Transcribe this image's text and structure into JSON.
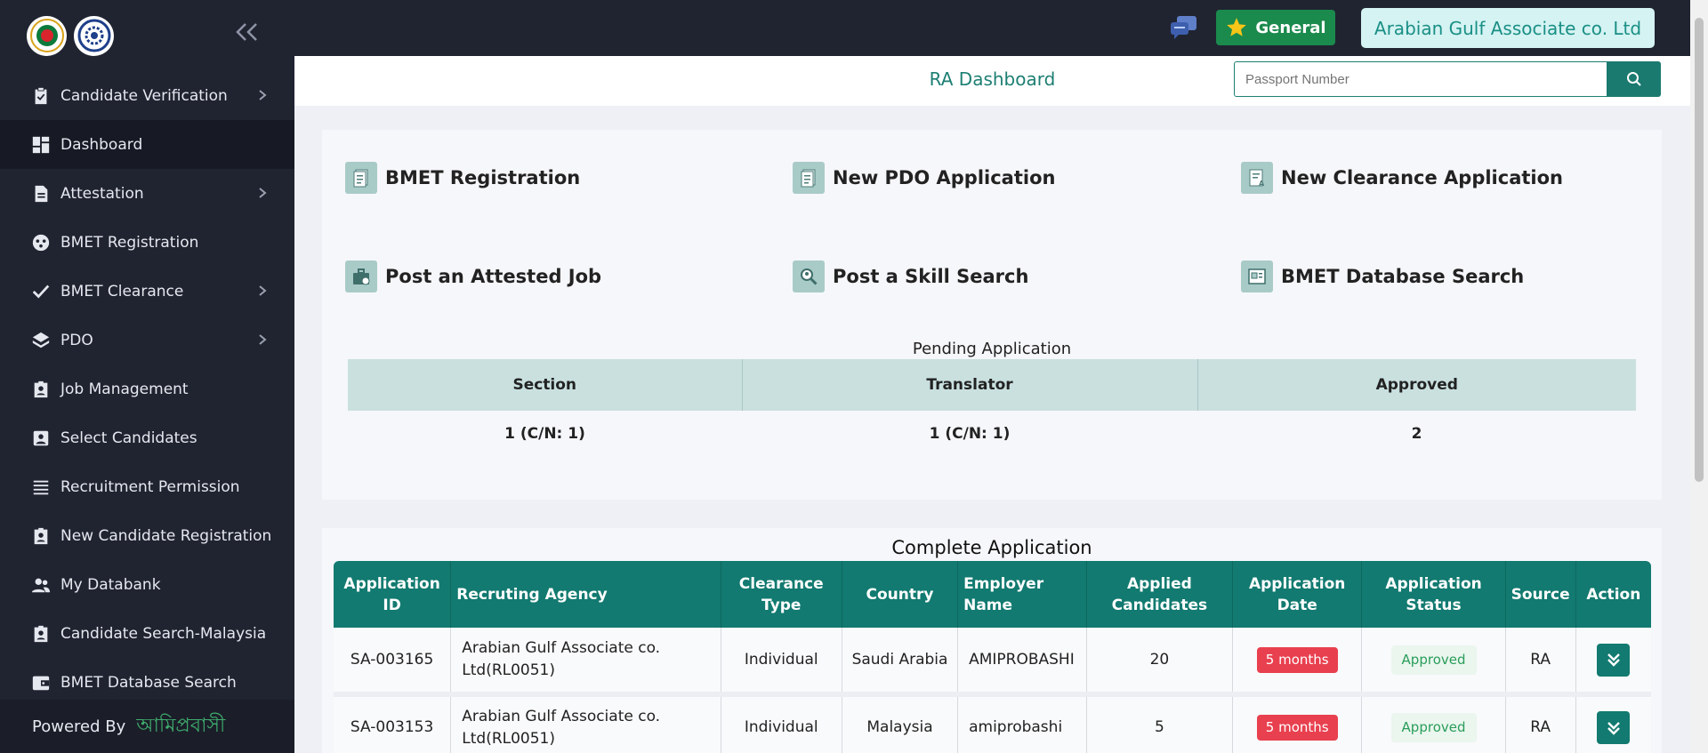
{
  "sidebar": {
    "items": [
      {
        "label": "Candidate Verification",
        "icon": "clipboard-check-icon",
        "chevron": true
      },
      {
        "label": "Dashboard",
        "icon": "dashboard-icon",
        "chevron": false,
        "active": true
      },
      {
        "label": "Attestation",
        "icon": "document-icon",
        "chevron": true
      },
      {
        "label": "BMET Registration",
        "icon": "registration-icon",
        "chevron": false
      },
      {
        "label": "BMET Clearance",
        "icon": "check-icon",
        "chevron": true
      },
      {
        "label": "PDO",
        "icon": "layers-icon",
        "chevron": true
      },
      {
        "label": "Job Management",
        "icon": "badge-icon",
        "chevron": false
      },
      {
        "label": "Select Candidates",
        "icon": "contact-icon",
        "chevron": false
      },
      {
        "label": "Recruitment Permission",
        "icon": "list-icon",
        "chevron": false
      },
      {
        "label": "New Candidate Registration",
        "icon": "badge-icon",
        "chevron": false
      },
      {
        "label": "My Databank",
        "icon": "people-icon",
        "chevron": false
      },
      {
        "label": "Candidate Search-Malaysia",
        "icon": "badge-icon",
        "chevron": false
      },
      {
        "label": "BMET Database Search",
        "icon": "wallet-icon",
        "chevron": false
      }
    ],
    "powered_by": "Powered By",
    "powered_logo": "আমিপ্রবাসী"
  },
  "topbar": {
    "general_label": "General",
    "agency_label": "Arabian Gulf Associate co. Ltd"
  },
  "header": {
    "title": "RA Dashboard",
    "search_placeholder": "Passport Number"
  },
  "actions": [
    {
      "label": "BMET Registration",
      "icon": "registration-doc-icon"
    },
    {
      "label": "New PDO Application",
      "icon": "pdo-doc-icon"
    },
    {
      "label": "New Clearance Application",
      "icon": "clearance-doc-icon"
    },
    {
      "label": "Post an Attested Job",
      "icon": "briefcase-icon"
    },
    {
      "label": "Post a Skill Search",
      "icon": "skill-search-icon"
    },
    {
      "label": "BMET Database Search",
      "icon": "database-search-icon"
    }
  ],
  "pending": {
    "title": "Pending Application",
    "headers": [
      "Section",
      "Translator",
      "Approved"
    ],
    "values": [
      "1 (C/N: 1)",
      "1 (C/N: 1)",
      "2"
    ]
  },
  "complete": {
    "title": "Complete Application",
    "headers": [
      "Application ID",
      "Recruting Agency",
      "Clearance Type",
      "Country",
      "Employer Name",
      "Applied Candidates",
      "Application Date",
      "Application Status",
      "Source",
      "Action"
    ],
    "rows": [
      {
        "id": "SA-003165",
        "agency": "Arabian Gulf Associate co. Ltd(RL0051)",
        "type": "Individual",
        "country": "Saudi Arabia",
        "employer": "AMIPROBASHI",
        "applied": "20",
        "date": "5 months",
        "status": "Approved",
        "source": "RA"
      },
      {
        "id": "SA-003153",
        "agency": "Arabian Gulf Associate co. Ltd(RL0051)",
        "type": "Individual",
        "country": "Malaysia",
        "employer": "amiprobashi",
        "applied": "5",
        "date": "5 months",
        "status": "Approved",
        "source": "RA"
      }
    ]
  },
  "colors": {
    "sidebar_bg": "#202431",
    "accent_teal": "#127a70",
    "general_green": "#1b8a4d",
    "badge_red": "#e8404f"
  }
}
